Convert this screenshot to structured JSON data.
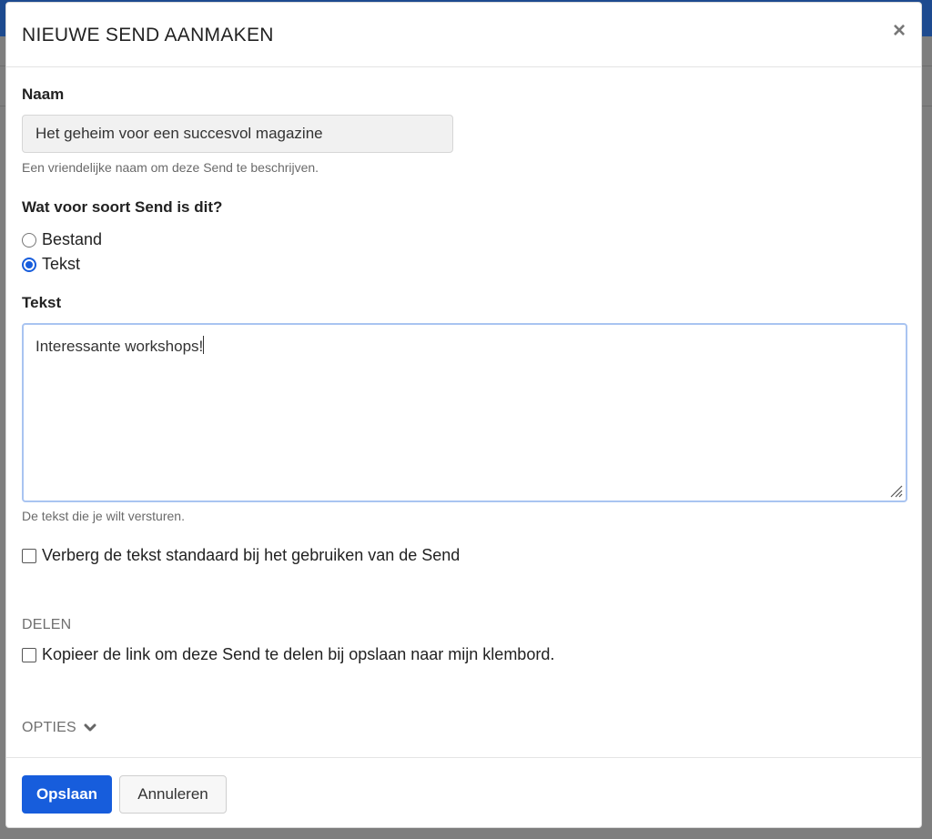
{
  "modal": {
    "title": "NIEUWE SEND AANMAKEN",
    "close_icon": "×"
  },
  "name_field": {
    "label": "Naam",
    "value": "Het geheim voor een succesvol magazine",
    "help": "Een vriendelijke naam om deze Send te beschrijven."
  },
  "type_field": {
    "label": "Wat voor soort Send is dit?",
    "options": [
      {
        "label": "Bestand",
        "checked": false
      },
      {
        "label": "Tekst",
        "checked": true
      }
    ]
  },
  "text_field": {
    "label": "Tekst",
    "value": "Interessante workshops!",
    "help": "De tekst die je wilt versturen.",
    "hide_label": "Verberg de tekst standaard bij het gebruiken van de Send",
    "hide_checked": false
  },
  "share": {
    "heading": "DELEN",
    "copy_label": "Kopieer de link om deze Send te delen bij opslaan naar mijn klembord.",
    "copy_checked": false
  },
  "options": {
    "heading": "OPTIES",
    "icon": "chevron-down-icon"
  },
  "footer": {
    "save_label": "Opslaan",
    "cancel_label": "Annuleren"
  },
  "colors": {
    "primary": "#175ddc",
    "focus_border": "#a9c4f1"
  }
}
